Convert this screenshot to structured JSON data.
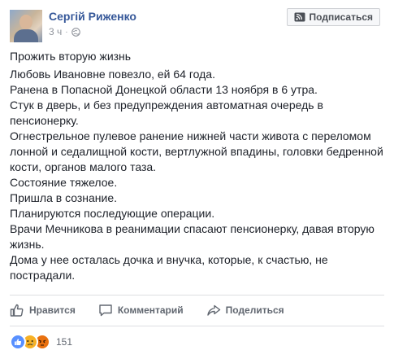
{
  "post": {
    "author": "Сергій Риженко",
    "time": "3 ч",
    "dot": "·",
    "subscribe_label": "Подписаться",
    "title": "Прожить вторую жизнь",
    "lines": [
      "Любовь Ивановне повезло, ей 64 года.",
      "Ранена в Попасной Донецкой области 13 ноября в 6 утра.",
      "Стук в дверь, и без предупреждения автоматная очередь в пенсионерку.",
      "Огнестрельное пулевое ранение нижней части живота с переломом лонной и седалищной кости, вертлужной впадины, головки бедренной кости, органов малого таза.",
      "Состояние тяжелое.",
      "Пришла в сознание.",
      "Планируются последующие операции.",
      "Врачи Мечникова в реанимации спасают пенсионерку, давая вторую жизнь.",
      "Дома у нее осталась дочка и внучка, которые, к счастью, не пострадали."
    ]
  },
  "actions": {
    "like_label": "Нравится",
    "comment_label": "Комментарий",
    "share_label": "Поделиться"
  },
  "reactions": {
    "icons": [
      "like-icon",
      "sad-icon",
      "angry-icon"
    ],
    "count": "151",
    "colors": {
      "like": "#5890ff",
      "sad": "#f7b125",
      "angry": "#e9710f"
    }
  }
}
